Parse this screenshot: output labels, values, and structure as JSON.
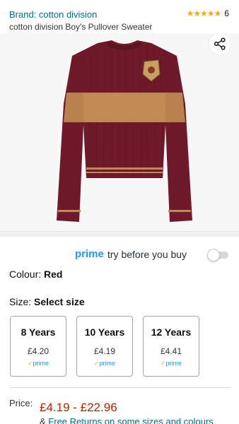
{
  "header": {
    "brand": "Brand: cotton division",
    "product_name": "cotton division Boy's Pullover Sweater",
    "stars": "★★★★★",
    "rating_count": "6"
  },
  "image": {
    "share_icon": "share-icon"
  },
  "prime": {
    "word": "prime",
    "tagline": "try before you buy",
    "toggle_state": "off"
  },
  "colour": {
    "label": "Colour:",
    "value": "Red"
  },
  "size": {
    "label": "Size:",
    "value": "Select size",
    "options": [
      {
        "label": "8 Years",
        "price": "£4.20",
        "prime": "prime"
      },
      {
        "label": "10 Years",
        "price": "£4.19",
        "prime": "prime"
      },
      {
        "label": "12 Years",
        "price": "£4.41",
        "prime": "prime"
      }
    ]
  },
  "price": {
    "label": "Price:",
    "range": "£4.19 - £22.96",
    "returns_prefix": "&",
    "returns_link": "Free Returns on some sizes and colours"
  },
  "colors": {
    "accent_link": "#007185",
    "prime_blue": "#1a98ff",
    "price_red": "#B12704",
    "star_orange": "#FFA41C"
  }
}
